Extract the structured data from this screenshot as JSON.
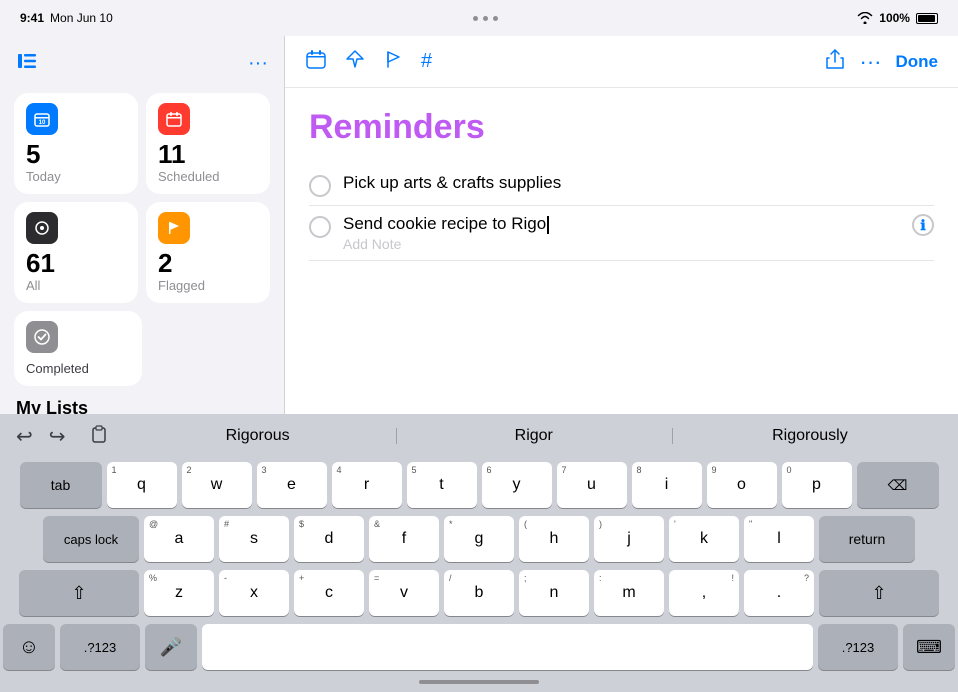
{
  "status_bar": {
    "time": "9:41",
    "date": "Mon Jun 10",
    "wifi_icon": "wifi",
    "battery": "100%"
  },
  "sidebar": {
    "toggle_label": "sidebar-toggle",
    "more_label": "more",
    "smart_lists": [
      {
        "id": "today",
        "icon": "calendar",
        "icon_color": "blue",
        "count": "5",
        "label": "Today"
      },
      {
        "id": "scheduled",
        "icon": "calendar-scheduled",
        "icon_color": "red",
        "count": "11",
        "label": "Scheduled"
      },
      {
        "id": "all",
        "icon": "all",
        "icon_color": "dark",
        "count": "61",
        "label": "All"
      },
      {
        "id": "flagged",
        "icon": "flag",
        "icon_color": "orange",
        "count": "2",
        "label": "Flagged"
      }
    ],
    "completed": {
      "icon": "checkmark",
      "label": "Completed"
    },
    "my_lists_heading": "My Lists"
  },
  "toolbar": {
    "icons": [
      "calendar-toolbar",
      "location-arrow",
      "flag-toolbar",
      "hashtag"
    ],
    "share_icon": "share",
    "more_icon": "more",
    "done_label": "Done"
  },
  "reminders": {
    "title": "Reminders",
    "items": [
      {
        "id": "item1",
        "text": "Pick up arts & crafts supplies",
        "active": false,
        "add_note": ""
      },
      {
        "id": "item2",
        "text": "Send cookie recipe to Rigo",
        "active": true,
        "add_note": "Add Note"
      }
    ]
  },
  "keyboard": {
    "autocomplete": {
      "undo_label": "↩",
      "redo_label": "↪",
      "paste_label": "⎘",
      "suggestions": [
        "Rigorous",
        "Rigor",
        "Rigorously"
      ]
    },
    "rows": [
      {
        "keys": [
          {
            "label": "tab",
            "type": "dark",
            "size": "tab"
          },
          {
            "label": "q",
            "num": "1",
            "type": "light",
            "size": "letter"
          },
          {
            "label": "w",
            "num": "2",
            "type": "light",
            "size": "letter"
          },
          {
            "label": "e",
            "num": "3",
            "type": "light",
            "size": "letter"
          },
          {
            "label": "r",
            "num": "4",
            "type": "light",
            "size": "letter"
          },
          {
            "label": "t",
            "num": "5",
            "type": "light",
            "size": "letter"
          },
          {
            "label": "y",
            "num": "6",
            "type": "light",
            "size": "letter"
          },
          {
            "label": "u",
            "num": "7",
            "type": "light",
            "size": "letter"
          },
          {
            "label": "i",
            "num": "8",
            "type": "light",
            "size": "letter"
          },
          {
            "label": "o",
            "num": "9",
            "type": "light",
            "size": "letter"
          },
          {
            "label": "p",
            "num": "0",
            "type": "light",
            "size": "letter"
          },
          {
            "label": "delete",
            "type": "dark",
            "size": "delete"
          }
        ]
      },
      {
        "keys": [
          {
            "label": "caps lock",
            "type": "dark",
            "size": "capslock"
          },
          {
            "label": "a",
            "num": "@",
            "type": "light",
            "size": "letter"
          },
          {
            "label": "s",
            "num": "#",
            "type": "light",
            "size": "letter"
          },
          {
            "label": "d",
            "num": "$",
            "type": "light",
            "size": "letter"
          },
          {
            "label": "f",
            "num": "&",
            "type": "light",
            "size": "letter"
          },
          {
            "label": "g",
            "num": "*",
            "type": "light",
            "size": "letter"
          },
          {
            "label": "h",
            "num": "(",
            "type": "light",
            "size": "letter"
          },
          {
            "label": "j",
            "num": ")",
            "type": "light",
            "size": "letter"
          },
          {
            "label": "k",
            "num": "'",
            "type": "light",
            "size": "letter"
          },
          {
            "label": "l",
            "num": "\"",
            "type": "light",
            "size": "letter"
          },
          {
            "label": "return",
            "type": "dark",
            "size": "return"
          }
        ]
      },
      {
        "keys": [
          {
            "label": "shift",
            "type": "dark",
            "size": "shift"
          },
          {
            "label": "z",
            "num": "%",
            "type": "light",
            "size": "letter"
          },
          {
            "label": "x",
            "num": "-",
            "type": "light",
            "size": "letter"
          },
          {
            "label": "c",
            "num": "+",
            "type": "light",
            "size": "letter"
          },
          {
            "label": "v",
            "num": "=",
            "type": "light",
            "size": "letter"
          },
          {
            "label": "b",
            "num": "/",
            "type": "light",
            "size": "letter"
          },
          {
            "label": "n",
            "num": ";",
            "type": "light",
            "size": "letter"
          },
          {
            "label": "m",
            "num": ":",
            "type": "light",
            "size": "letter"
          },
          {
            "label": "!",
            "type": "light",
            "size": "letter"
          },
          {
            "label": "?",
            "type": "light",
            "size": "letter"
          },
          {
            "label": "shift",
            "type": "dark",
            "size": "shift"
          }
        ]
      },
      {
        "keys": [
          {
            "label": "😊",
            "type": "dark",
            "size": "emoji"
          },
          {
            "label": ".?123",
            "type": "dark",
            "size": "num123"
          },
          {
            "label": "🎤",
            "type": "dark",
            "size": "mic"
          },
          {
            "label": "",
            "type": "light",
            "size": "space"
          },
          {
            "label": ".?123",
            "type": "dark",
            "size": "num123"
          },
          {
            "label": "⌨",
            "type": "dark",
            "size": "hide"
          }
        ]
      }
    ]
  }
}
